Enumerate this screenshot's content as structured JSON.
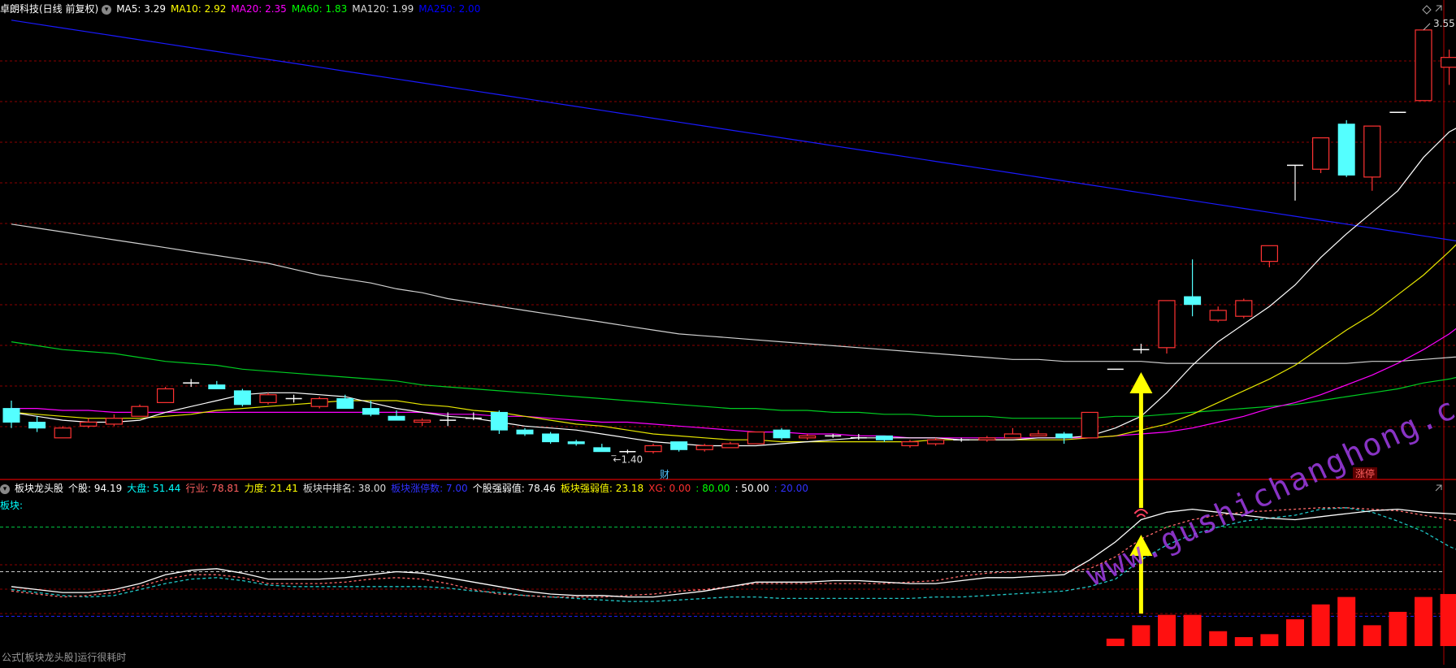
{
  "main_panel": {
    "stock_name": "卓朗科技(日线 前复权)",
    "ma_legend": [
      {
        "label": "MA5: 3.29",
        "color": "#ffffff"
      },
      {
        "label": "MA10: 2.92",
        "color": "#ffff00"
      },
      {
        "label": "MA20: 2.35",
        "color": "#ff00ff"
      },
      {
        "label": "MA60: 1.83",
        "color": "#00ff00"
      },
      {
        "label": "MA120: 1.99",
        "color": "#dddddd"
      },
      {
        "label": "MA250: 2.00",
        "color": "#0000ff"
      }
    ],
    "high_label": "3.55",
    "low_label": "1.40",
    "marker_cai": "财",
    "marker_zhangting": "涨停"
  },
  "sub_panel": {
    "indicator_name": "板块龙头股",
    "metrics": [
      {
        "label": "个股: 94.19",
        "color": "#ffffff"
      },
      {
        "label": "大盘: 51.44",
        "color": "#00ffff"
      },
      {
        "label": "行业: 78.81",
        "color": "#ff6060"
      },
      {
        "label": "力度: 21.41",
        "color": "#ffff00"
      },
      {
        "label": "板块中排名: 38.00",
        "color": "#dddddd"
      },
      {
        "label": "板块涨停数: 7.00",
        "color": "#3030ff"
      },
      {
        "label": "个股强弱值: 78.46",
        "color": "#ffffff"
      },
      {
        "label": "板块强弱值: 23.18",
        "color": "#ffff00"
      },
      {
        "label": "XG: 0.00",
        "color": "#ff3030"
      },
      {
        "label": ": 80.00",
        "color": "#00ff00"
      },
      {
        "label": ": 50.00",
        "color": "#ffffff"
      },
      {
        "label": ": 20.00",
        "color": "#3030ff"
      }
    ],
    "sector_label": "板块:"
  },
  "chart_data": {
    "type": "candlestick",
    "candles": [
      {
        "o": 1.62,
        "h": 1.66,
        "l": 1.52,
        "c": 1.55
      },
      {
        "o": 1.55,
        "h": 1.58,
        "l": 1.5,
        "c": 1.52
      },
      {
        "o": 1.47,
        "h": 1.53,
        "l": 1.47,
        "c": 1.52
      },
      {
        "o": 1.53,
        "h": 1.57,
        "l": 1.52,
        "c": 1.55
      },
      {
        "o": 1.54,
        "h": 1.59,
        "l": 1.53,
        "c": 1.57
      },
      {
        "o": 1.58,
        "h": 1.64,
        "l": 1.58,
        "c": 1.63
      },
      {
        "o": 1.65,
        "h": 1.73,
        "l": 1.65,
        "c": 1.72
      },
      {
        "o": 1.75,
        "h": 1.77,
        "l": 1.73,
        "c": 1.75
      },
      {
        "o": 1.74,
        "h": 1.76,
        "l": 1.72,
        "c": 1.72
      },
      {
        "o": 1.71,
        "h": 1.72,
        "l": 1.63,
        "c": 1.64
      },
      {
        "o": 1.65,
        "h": 1.7,
        "l": 1.64,
        "c": 1.69
      },
      {
        "o": 1.67,
        "h": 1.69,
        "l": 1.65,
        "c": 1.67
      },
      {
        "o": 1.63,
        "h": 1.68,
        "l": 1.62,
        "c": 1.67
      },
      {
        "o": 1.67,
        "h": 1.69,
        "l": 1.62,
        "c": 1.62
      },
      {
        "o": 1.62,
        "h": 1.66,
        "l": 1.58,
        "c": 1.59
      },
      {
        "o": 1.58,
        "h": 1.61,
        "l": 1.56,
        "c": 1.56
      },
      {
        "o": 1.55,
        "h": 1.57,
        "l": 1.53,
        "c": 1.56
      },
      {
        "o": 1.56,
        "h": 1.6,
        "l": 1.53,
        "c": 1.56
      },
      {
        "o": 1.57,
        "h": 1.6,
        "l": 1.56,
        "c": 1.57
      },
      {
        "o": 1.6,
        "h": 1.61,
        "l": 1.49,
        "c": 1.51
      },
      {
        "o": 1.51,
        "h": 1.52,
        "l": 1.48,
        "c": 1.49
      },
      {
        "o": 1.49,
        "h": 1.5,
        "l": 1.44,
        "c": 1.45
      },
      {
        "o": 1.45,
        "h": 1.46,
        "l": 1.43,
        "c": 1.44
      },
      {
        "o": 1.42,
        "h": 1.44,
        "l": 1.4,
        "c": 1.4
      },
      {
        "o": 1.4,
        "h": 1.41,
        "l": 1.39,
        "c": 1.4
      },
      {
        "o": 1.4,
        "h": 1.44,
        "l": 1.39,
        "c": 1.43
      },
      {
        "o": 1.45,
        "h": 1.45,
        "l": 1.4,
        "c": 1.41
      },
      {
        "o": 1.41,
        "h": 1.44,
        "l": 1.4,
        "c": 1.43
      },
      {
        "o": 1.42,
        "h": 1.45,
        "l": 1.42,
        "c": 1.44
      },
      {
        "o": 1.44,
        "h": 1.5,
        "l": 1.44,
        "c": 1.5
      },
      {
        "o": 1.51,
        "h": 1.52,
        "l": 1.46,
        "c": 1.47
      },
      {
        "o": 1.47,
        "h": 1.49,
        "l": 1.46,
        "c": 1.48
      },
      {
        "o": 1.48,
        "h": 1.49,
        "l": 1.47,
        "c": 1.48
      },
      {
        "o": 1.47,
        "h": 1.49,
        "l": 1.46,
        "c": 1.47
      },
      {
        "o": 1.48,
        "h": 1.48,
        "l": 1.45,
        "c": 1.46
      },
      {
        "o": 1.43,
        "h": 1.46,
        "l": 1.42,
        "c": 1.45
      },
      {
        "o": 1.44,
        "h": 1.47,
        "l": 1.43,
        "c": 1.46
      },
      {
        "o": 1.46,
        "h": 1.47,
        "l": 1.45,
        "c": 1.46
      },
      {
        "o": 1.46,
        "h": 1.48,
        "l": 1.45,
        "c": 1.47
      },
      {
        "o": 1.47,
        "h": 1.52,
        "l": 1.47,
        "c": 1.49
      },
      {
        "o": 1.48,
        "h": 1.51,
        "l": 1.48,
        "c": 1.49
      },
      {
        "o": 1.49,
        "h": 1.5,
        "l": 1.44,
        "c": 1.47
      },
      {
        "o": 1.47,
        "h": 1.6,
        "l": 1.47,
        "c": 1.6
      },
      {
        "o": 1.82,
        "h": 1.82,
        "l": 1.82,
        "c": 1.82
      },
      {
        "o": 1.92,
        "h": 1.95,
        "l": 1.9,
        "c": 1.92
      },
      {
        "o": 1.93,
        "h": 2.17,
        "l": 1.9,
        "c": 2.17
      },
      {
        "o": 2.19,
        "h": 2.38,
        "l": 2.09,
        "c": 2.15
      },
      {
        "o": 2.07,
        "h": 2.14,
        "l": 2.06,
        "c": 2.12
      },
      {
        "o": 2.09,
        "h": 2.18,
        "l": 2.08,
        "c": 2.17
      },
      {
        "o": 2.37,
        "h": 2.45,
        "l": 2.34,
        "c": 2.45
      },
      {
        "o": 2.86,
        "h": 2.86,
        "l": 2.68,
        "c": 2.86
      },
      {
        "o": 2.84,
        "h": 3.0,
        "l": 2.82,
        "c": 3.0
      },
      {
        "o": 3.07,
        "h": 3.09,
        "l": 2.8,
        "c": 2.81
      },
      {
        "o": 2.8,
        "h": 3.06,
        "l": 2.73,
        "c": 3.06
      },
      {
        "o": 3.13,
        "h": 3.13,
        "l": 3.13,
        "c": 3.13
      },
      {
        "o": 3.19,
        "h": 3.55,
        "l": 3.19,
        "c": 3.55
      },
      {
        "o": 3.36,
        "h": 3.45,
        "l": 3.27,
        "c": 3.41
      },
      {
        "o": 3.29,
        "h": 3.5,
        "l": 3.23,
        "c": 3.5
      }
    ],
    "ma5": [
      1.6,
      1.58,
      1.56,
      1.55,
      1.55,
      1.56,
      1.6,
      1.63,
      1.66,
      1.69,
      1.7,
      1.7,
      1.69,
      1.68,
      1.65,
      1.62,
      1.6,
      1.58,
      1.57,
      1.55,
      1.53,
      1.52,
      1.51,
      1.49,
      1.47,
      1.45,
      1.44,
      1.43,
      1.43,
      1.43,
      1.44,
      1.45,
      1.46,
      1.47,
      1.47,
      1.47,
      1.47,
      1.46,
      1.46,
      1.46,
      1.47,
      1.47,
      1.48,
      1.52,
      1.58,
      1.7,
      1.84,
      1.96,
      2.05,
      2.14,
      2.25,
      2.39,
      2.51,
      2.62,
      2.73,
      2.9,
      3.03,
      3.1,
      3.29
    ],
    "ma10": [
      1.6,
      1.59,
      1.58,
      1.57,
      1.57,
      1.57,
      1.58,
      1.59,
      1.61,
      1.62,
      1.63,
      1.64,
      1.65,
      1.66,
      1.66,
      1.66,
      1.64,
      1.63,
      1.61,
      1.6,
      1.58,
      1.56,
      1.54,
      1.53,
      1.51,
      1.49,
      1.48,
      1.47,
      1.46,
      1.46,
      1.45,
      1.45,
      1.45,
      1.45,
      1.45,
      1.45,
      1.46,
      1.46,
      1.46,
      1.46,
      1.46,
      1.46,
      1.47,
      1.48,
      1.51,
      1.54,
      1.59,
      1.65,
      1.71,
      1.77,
      1.84,
      1.93,
      2.02,
      2.1,
      2.2,
      2.3,
      2.42,
      2.55,
      2.92
    ],
    "ma20": [
      1.62,
      1.62,
      1.61,
      1.61,
      1.6,
      1.6,
      1.6,
      1.6,
      1.6,
      1.6,
      1.6,
      1.6,
      1.6,
      1.6,
      1.6,
      1.6,
      1.6,
      1.59,
      1.59,
      1.58,
      1.58,
      1.57,
      1.56,
      1.55,
      1.55,
      1.54,
      1.53,
      1.52,
      1.51,
      1.5,
      1.5,
      1.49,
      1.49,
      1.48,
      1.48,
      1.47,
      1.47,
      1.47,
      1.47,
      1.47,
      1.47,
      1.47,
      1.47,
      1.48,
      1.49,
      1.5,
      1.52,
      1.55,
      1.58,
      1.62,
      1.65,
      1.69,
      1.74,
      1.79,
      1.85,
      1.92,
      2.0,
      2.1,
      2.35
    ],
    "ma60": [
      1.96,
      1.94,
      1.92,
      1.91,
      1.9,
      1.88,
      1.86,
      1.85,
      1.84,
      1.82,
      1.81,
      1.8,
      1.79,
      1.78,
      1.77,
      1.76,
      1.74,
      1.73,
      1.72,
      1.71,
      1.7,
      1.69,
      1.68,
      1.67,
      1.66,
      1.65,
      1.64,
      1.63,
      1.62,
      1.62,
      1.61,
      1.61,
      1.6,
      1.6,
      1.59,
      1.59,
      1.58,
      1.58,
      1.58,
      1.57,
      1.57,
      1.57,
      1.57,
      1.58,
      1.58,
      1.59,
      1.6,
      1.61,
      1.62,
      1.63,
      1.64,
      1.66,
      1.68,
      1.7,
      1.72,
      1.75,
      1.77,
      1.8,
      1.83
    ],
    "ma120": [
      2.56,
      2.54,
      2.52,
      2.5,
      2.48,
      2.46,
      2.44,
      2.42,
      2.4,
      2.38,
      2.36,
      2.33,
      2.3,
      2.28,
      2.26,
      2.23,
      2.21,
      2.18,
      2.16,
      2.14,
      2.12,
      2.1,
      2.08,
      2.06,
      2.04,
      2.02,
      2.0,
      1.99,
      1.98,
      1.97,
      1.96,
      1.95,
      1.94,
      1.93,
      1.92,
      1.91,
      1.9,
      1.89,
      1.88,
      1.87,
      1.87,
      1.86,
      1.86,
      1.86,
      1.86,
      1.85,
      1.85,
      1.85,
      1.85,
      1.85,
      1.85,
      1.85,
      1.85,
      1.86,
      1.86,
      1.87,
      1.88,
      1.89,
      1.99
    ],
    "ma250": [
      3.6,
      3.58,
      3.56,
      3.54,
      3.52,
      3.5,
      3.48,
      3.46,
      3.44,
      3.42,
      3.4,
      3.38,
      3.36,
      3.34,
      3.32,
      3.3,
      3.28,
      3.26,
      3.24,
      3.22,
      3.2,
      3.18,
      3.16,
      3.14,
      3.12,
      3.1,
      3.08,
      3.06,
      3.04,
      3.02,
      3.0,
      2.98,
      2.96,
      2.94,
      2.92,
      2.9,
      2.88,
      2.86,
      2.84,
      2.82,
      2.8,
      2.78,
      2.76,
      2.74,
      2.72,
      2.7,
      2.68,
      2.66,
      2.64,
      2.62,
      2.6,
      2.58,
      2.56,
      2.54,
      2.52,
      2.5,
      2.48,
      2.46,
      2.0
    ],
    "sub_lines": {
      "gegu": [
        40,
        38,
        36,
        36,
        38,
        42,
        48,
        51,
        52,
        49,
        45,
        45,
        45,
        46,
        48,
        50,
        49,
        46,
        43,
        40,
        37,
        35,
        34,
        34,
        33,
        33,
        35,
        37,
        40,
        43,
        43,
        43,
        44,
        44,
        43,
        42,
        42,
        44,
        46,
        46,
        47,
        48,
        58,
        70,
        85,
        90,
        92,
        90,
        88,
        86,
        85,
        87,
        89,
        91,
        92,
        90,
        89,
        88,
        94
      ],
      "hangye": [
        37,
        35,
        33,
        34,
        36,
        40,
        45,
        48,
        48,
        46,
        42,
        42,
        42,
        43,
        45,
        46,
        45,
        42,
        38,
        35,
        34,
        33,
        33,
        33,
        34,
        35,
        37,
        38,
        40,
        42,
        42,
        42,
        42,
        42,
        42,
        43,
        44,
        47,
        49,
        50,
        50,
        50,
        52,
        60,
        72,
        80,
        85,
        88,
        90,
        91,
        92,
        93,
        93,
        92,
        91,
        88,
        85,
        82,
        78
      ],
      "dapan": [
        38,
        36,
        34,
        33,
        34,
        38,
        42,
        45,
        46,
        44,
        41,
        40,
        40,
        40,
        40,
        40,
        40,
        39,
        37,
        36,
        34,
        33,
        32,
        31,
        30,
        30,
        31,
        32,
        33,
        33,
        32,
        32,
        32,
        32,
        32,
        32,
        33,
        33,
        34,
        35,
        36,
        37,
        40,
        45,
        58,
        68,
        75,
        80,
        84,
        86,
        88,
        92,
        93,
        90,
        84,
        77,
        67,
        60,
        52
      ]
    },
    "sub_bars": {
      "start_index": 43,
      "values": [
        5,
        14,
        21,
        21,
        10,
        6,
        8,
        18,
        28,
        33,
        14,
        23,
        33,
        35,
        20,
        26
      ]
    },
    "sub_levels": [
      80,
      50,
      20
    ]
  },
  "status_bar": {
    "formula_text": "公式[板块龙头股]运行很耗时"
  },
  "watermark": {
    "text": "www.gushichanghong.com"
  },
  "colors": {
    "up": "#ff3232",
    "down": "#54ffff",
    "grid": "#8b0000",
    "background": "#000000"
  }
}
